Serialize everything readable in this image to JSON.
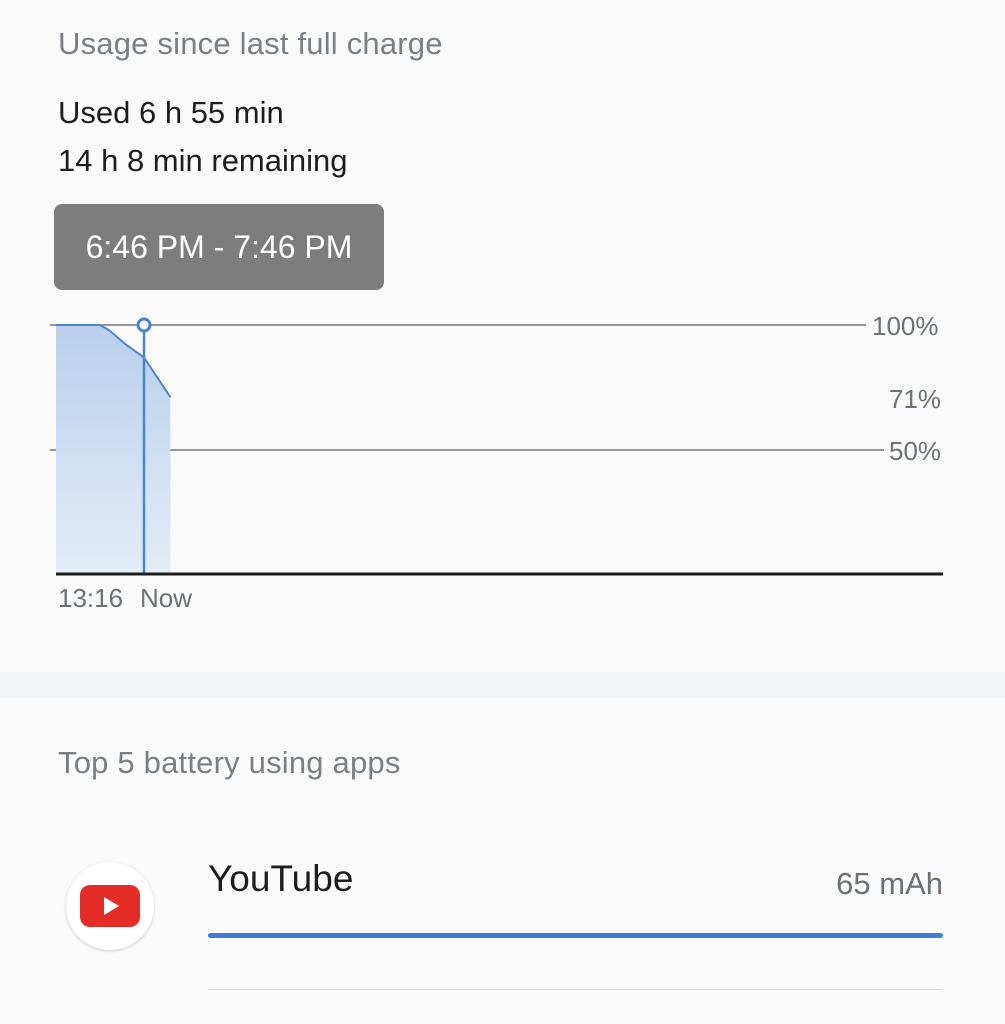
{
  "usage": {
    "title": "Usage since last full charge",
    "used": "Used 6 h 55 min",
    "remaining": "14 h 8 min remaining",
    "tooltip": "6:46 PM - 7:46 PM"
  },
  "chart": {
    "label_100": "100%",
    "label_71": "71%",
    "label_50": "50%",
    "time_start": "13:16",
    "time_now": "Now",
    "line_color": "#4a86d0",
    "fill_color": "#c8d9ee"
  },
  "chart_data": {
    "type": "area",
    "title": "",
    "xlabel": "",
    "ylabel": "",
    "x": [
      0,
      0.5,
      0.6,
      0.8,
      1.0,
      1.3
    ],
    "values": [
      100,
      100,
      98,
      92,
      87,
      71
    ],
    "ylim": [
      0,
      100
    ],
    "ticks": [
      "100%",
      "50%"
    ],
    "current_marker": {
      "x": 1.0,
      "y": 100
    },
    "grid": true
  },
  "apps": {
    "title": "Top 5 battery using apps",
    "items": [
      {
        "name": "YouTube",
        "usage": "65 mAh",
        "fraction": 1.0,
        "icon": "youtube-icon",
        "icon_color": "#e52d27"
      }
    ]
  }
}
